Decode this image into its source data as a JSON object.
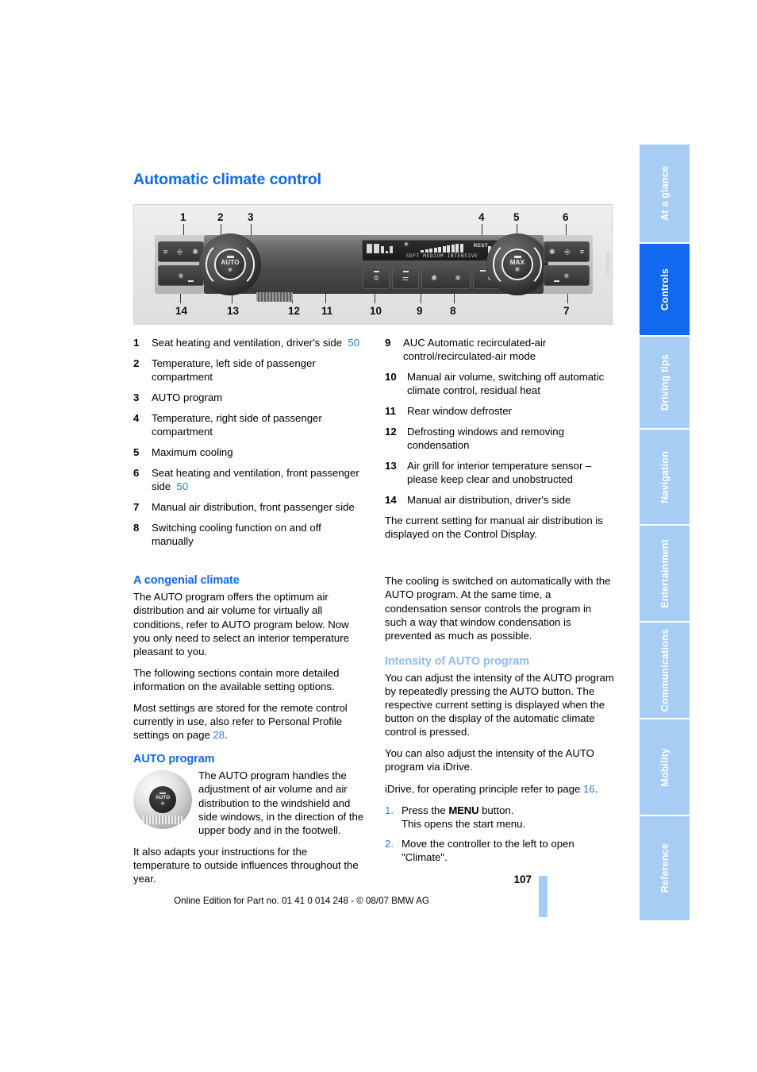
{
  "page": {
    "title": "Automatic climate control",
    "number": "107",
    "imprint": "Online Edition for Part no. 01 41 0 014 248 - © 08/07 BMW AG"
  },
  "tabs": [
    {
      "label": "At a glance",
      "active": false
    },
    {
      "label": "Controls",
      "active": true
    },
    {
      "label": "Driving tips",
      "active": false
    },
    {
      "label": "Navigation",
      "active": false
    },
    {
      "label": "Entertainment",
      "active": false
    },
    {
      "label": "Communications",
      "active": false
    },
    {
      "label": "Mobility",
      "active": false
    },
    {
      "label": "Reference",
      "active": false
    }
  ],
  "figure": {
    "callouts": [
      "1",
      "2",
      "3",
      "4",
      "5",
      "6",
      "7",
      "8",
      "9",
      "10",
      "11",
      "12",
      "13",
      "14"
    ],
    "knob_left_label": "AUTO",
    "knob_right_label": "MAX",
    "lcd_scale": "SOFT  MEDIUM  INTENSIVE",
    "lcd_rest": "REST"
  },
  "legend": {
    "left": [
      {
        "num": "1",
        "text": "Seat heating and ventilation, driver's side",
        "ref": "50"
      },
      {
        "num": "2",
        "text": "Temperature, left side of passenger compartment",
        "ref": ""
      },
      {
        "num": "3",
        "text": "AUTO program",
        "ref": ""
      },
      {
        "num": "4",
        "text": "Temperature, right side of passenger compartment",
        "ref": ""
      },
      {
        "num": "5",
        "text": "Maximum cooling",
        "ref": ""
      },
      {
        "num": "6",
        "text": "Seat heating and ventilation, front passenger side",
        "ref": "50"
      },
      {
        "num": "7",
        "text": "Manual air distribution, front passenger side",
        "ref": ""
      },
      {
        "num": "8",
        "text": "Switching cooling function on and off manually",
        "ref": ""
      }
    ],
    "right": [
      {
        "num": "9",
        "text": "AUC Automatic recirculated-air control/recirculated-air mode",
        "ref": ""
      },
      {
        "num": "10",
        "text": "Manual air volume, switching off automatic climate control, residual heat",
        "ref": ""
      },
      {
        "num": "11",
        "text": "Rear window defroster",
        "ref": ""
      },
      {
        "num": "12",
        "text": "Defrosting windows and removing condensation",
        "ref": ""
      },
      {
        "num": "13",
        "text": "Air grill for interior temperature sensor – please keep clear and unobstructed",
        "ref": ""
      },
      {
        "num": "14",
        "text": "Manual air distribution, driver's side",
        "ref": ""
      }
    ],
    "note": "The current setting for manual air distribution is displayed on the Control Display."
  },
  "left_column": {
    "congenial_heading": "A congenial climate",
    "congenial_p1": "The AUTO program offers the optimum air distribution and air volume for virtually all conditions, refer to AUTO program below. Now you only need to select an interior temperature pleasant to you.",
    "congenial_p2": "The following sections contain more detailed information on the available setting options.",
    "congenial_p3_pre": "Most settings are stored for the remote control currently in use, also refer to Personal Profile settings on page ",
    "congenial_p3_ref": "28",
    "congenial_p3_post": ".",
    "auto_heading_bold": "AUTO",
    "auto_heading_rest": " program",
    "auto_p1": "The AUTO program handles the adjustment of air volume and air distribution to the windshield and side windows, in the direction of the upper body and in the footwell.",
    "auto_p2": "It also adapts your instructions for the temperature to outside influences throughout the year."
  },
  "right_column": {
    "cooling_p": "The cooling is switched on automatically with the AUTO program. At the same time, a condensation sensor controls the program in such a way that window condensation is prevented as much as possible.",
    "intensity_heading": "Intensity of AUTO program",
    "intensity_p1": "You can adjust the intensity of the AUTO program by repeatedly pressing the AUTO button. The respective current setting is displayed when the button on the display of the automatic climate control is pressed.",
    "intensity_p2": "You can also adjust the intensity of the AUTO program via iDrive.",
    "idrive_pre": "iDrive, for operating principle refer to page ",
    "idrive_ref": "16",
    "idrive_post": ".",
    "steps": [
      {
        "num": "1.",
        "pre": "Press the ",
        "kw": "MENU",
        "post": " button.",
        "sub": "This opens the start menu."
      },
      {
        "num": "2.",
        "pre": "Move the controller to the left to open \"Climate\".",
        "kw": "",
        "post": "",
        "sub": ""
      }
    ]
  },
  "colors": {
    "accent_blue": "#1169ef",
    "light_blue": "#a8cdf4",
    "soft_heading": "#8ebdf3",
    "link_blue": "#2a7ae2"
  }
}
